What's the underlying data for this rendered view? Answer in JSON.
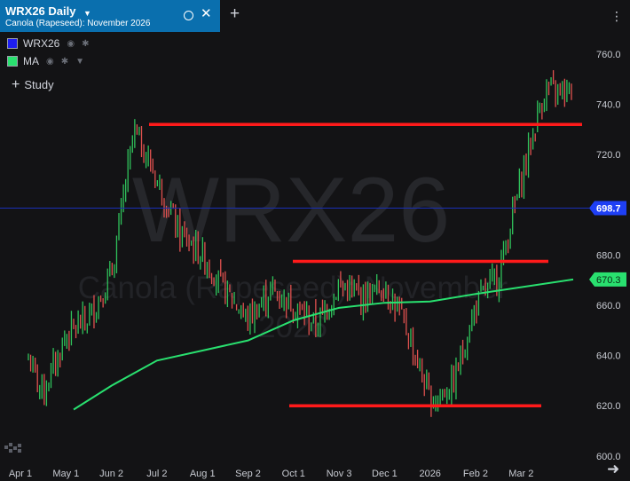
{
  "tab": {
    "title": "WRX26 Daily",
    "subtitle": "Canola (Rapeseed): November 2026",
    "close_label": "✕",
    "add_label": "+"
  },
  "menu_label": "⋮",
  "legend": [
    {
      "label": "WRX26",
      "color": "#1e1ef0",
      "icons": [
        "eye-icon",
        "gear-icon"
      ]
    },
    {
      "label": "MA",
      "color": "#29e06f",
      "icons": [
        "eye-icon",
        "gear-icon",
        "caret-down-icon"
      ]
    }
  ],
  "study_label": "Study",
  "colors": {
    "up": "#2fc25b",
    "down": "#e0514f",
    "ma": "#29e06f",
    "level_lines": "#ff1a1a",
    "crosshair": "#1a2fb8",
    "price_label_bg": "#1e3ff5"
  },
  "chart_data": {
    "type": "ohlc",
    "symbol": "WRX26",
    "watermark": "WRX26",
    "watermark_sub_1": "Canola (Rapeseed): November",
    "watermark_sub_2": "2026",
    "y_ticks": [
      "760.0",
      "740.0",
      "720.0",
      "700.0",
      "680.0",
      "660.0",
      "640.0",
      "620.0",
      "600.0"
    ],
    "ylim": [
      595,
      766
    ],
    "x_ticks": [
      "Apr 1",
      "May 1",
      "Jun 2",
      "Jul 2",
      "Aug 1",
      "Sep 2",
      "Oct 1",
      "Nov 3",
      "Dec 1",
      "2026",
      "Feb 2",
      "Mar 2"
    ],
    "current_price_label": "698.7",
    "current_price": 698.7,
    "ma_label": "670.3",
    "ma_value": 670.3,
    "ma_points": [
      [
        "Apr 1",
        618.5
      ],
      [
        "Jun 2",
        628
      ],
      [
        "Jul 2",
        638
      ],
      [
        "Aug 1",
        642
      ],
      [
        "Sep 2",
        646
      ],
      [
        "Oct 1",
        654
      ],
      [
        "Nov 3",
        659
      ],
      [
        "Dec 1",
        661
      ],
      [
        "2026",
        661.5
      ],
      [
        "Feb 2",
        664.5
      ],
      [
        "Mar 2",
        670.3
      ]
    ],
    "close_points": [
      [
        "Apr 1",
        646
      ],
      [
        "Apr 1",
        625
      ],
      [
        "May 1",
        648
      ],
      [
        "May 1",
        655
      ],
      [
        "Jun 2",
        672
      ],
      [
        "Jun 2",
        730
      ],
      [
        "Jul 2",
        710
      ],
      [
        "Jul 2",
        688
      ],
      [
        "Aug 1",
        680
      ],
      [
        "Aug 1",
        666
      ],
      [
        "Sep 2",
        654
      ],
      [
        "Sep 2",
        666
      ],
      [
        "Oct 1",
        660
      ],
      [
        "Oct 1",
        652
      ],
      [
        "Nov 3",
        668
      ],
      [
        "Nov 3",
        663
      ],
      [
        "Dec 1",
        668
      ],
      [
        "Dec 1",
        650
      ],
      [
        "2026",
        622
      ],
      [
        "2026",
        628
      ],
      [
        "Feb 2",
        660
      ],
      [
        "Feb 2",
        672
      ],
      [
        "Mar 2",
        710
      ],
      [
        "Mar 2",
        745
      ]
    ],
    "level_lines": [
      {
        "value": 732,
        "from": "Jun 2",
        "to": "Mar 2"
      },
      {
        "value": 677.5,
        "from": "Sep 2",
        "to": "Mar 2"
      },
      {
        "value": 620,
        "from": "Sep 2",
        "to": "Feb 2"
      }
    ],
    "crosshair_value": 698.7
  }
}
